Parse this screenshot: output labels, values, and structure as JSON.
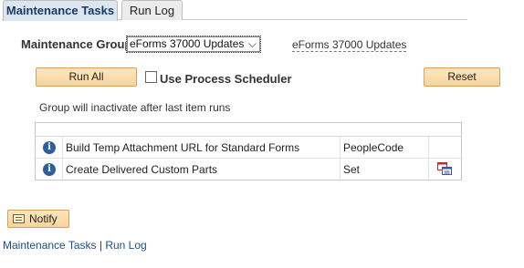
{
  "tabs": [
    {
      "label": "Maintenance Tasks",
      "active": true
    },
    {
      "label": "Run Log",
      "active": false
    }
  ],
  "group": {
    "label": "Maintenance Group",
    "selected": "eForms 37000 Updates",
    "description": "eForms 37000 Updates"
  },
  "actions": {
    "run_all": "Run All",
    "use_scheduler": "Use Process Scheduler",
    "use_scheduler_checked": false,
    "reset": "Reset"
  },
  "note": "Group will inactivate after last item runs",
  "tasks": [
    {
      "description": "Build Temp Attachment URL for Standard Forms",
      "type": "PeopleCode",
      "has_action_icon": false
    },
    {
      "description": "Create Delivered Custom Parts",
      "type": "Set",
      "has_action_icon": true
    }
  ],
  "notify": {
    "label": "Notify"
  },
  "footer": {
    "link1": "Maintenance Tasks",
    "separator": " | ",
    "link2": "Run Log"
  },
  "colors": {
    "button_bg": "#f8d49b",
    "button_border": "#d7a05b",
    "info_icon": "#2d5e9e",
    "link": "#1b4f8c"
  }
}
